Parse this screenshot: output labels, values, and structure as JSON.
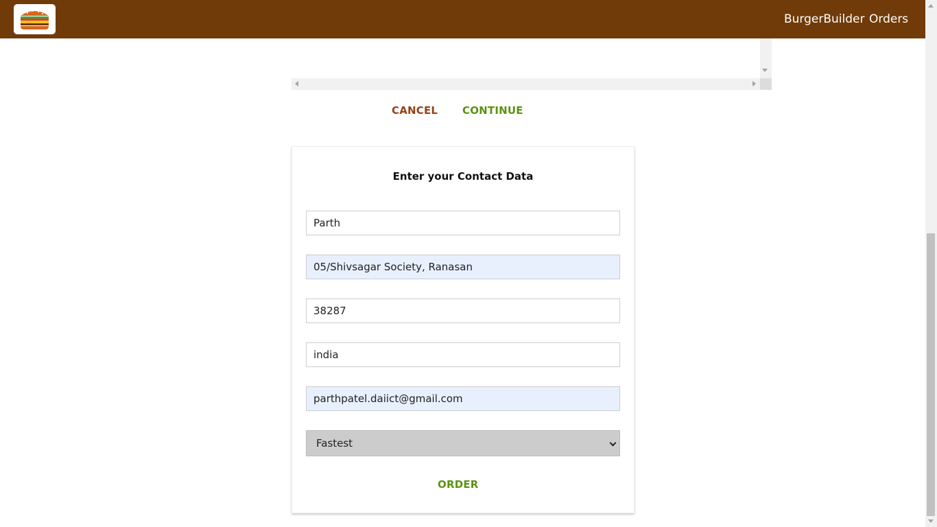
{
  "header": {
    "logo_icon": "burger-logo-icon",
    "nav_items": [
      {
        "label": "BurgerBuilder"
      },
      {
        "label": "Orders"
      }
    ],
    "background_color": "#703b09"
  },
  "checkout": {
    "cancel_label": "CANCEL",
    "continue_label": "CONTINUE",
    "cancel_color": "#944317",
    "continue_color": "#5c9210"
  },
  "contact_form": {
    "title": "Enter your Contact Data",
    "fields": [
      {
        "value": "Parth"
      },
      {
        "value": "05/Shivsagar Society, Ranasan"
      },
      {
        "value": "38287"
      },
      {
        "value": "india"
      },
      {
        "value": "parthpatel.daiict@gmail.com"
      }
    ],
    "delivery_method": {
      "selected": "Fastest"
    },
    "order_label": "ORDER"
  }
}
